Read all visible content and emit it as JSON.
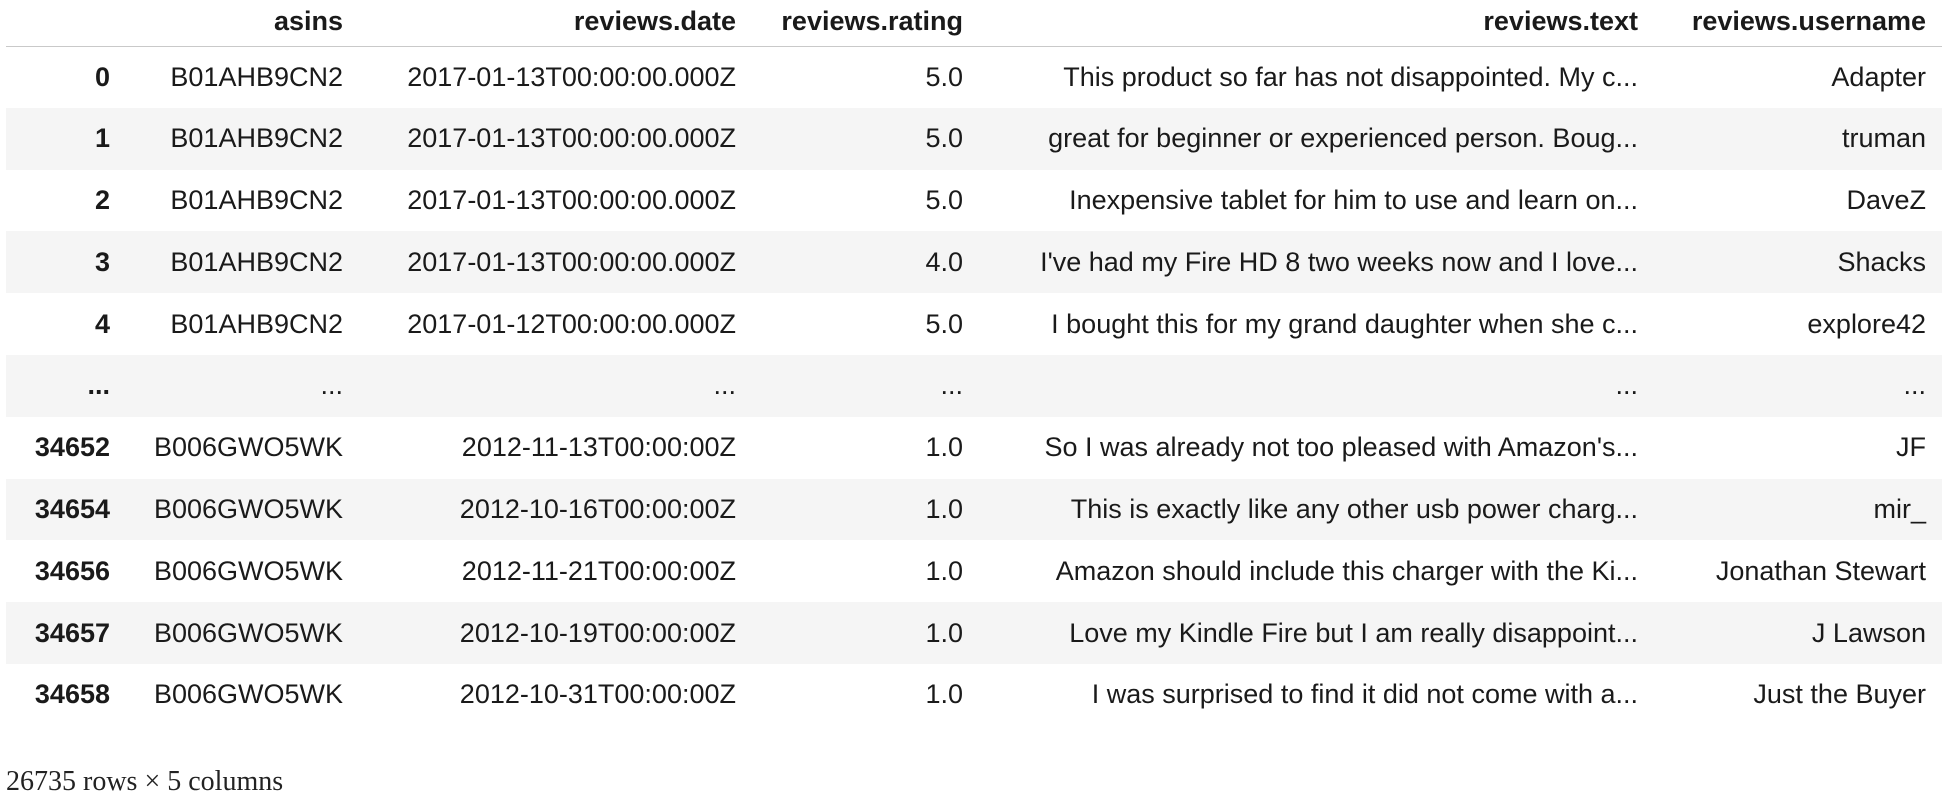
{
  "table": {
    "columns": [
      "",
      "asins",
      "reviews.date",
      "reviews.rating",
      "reviews.text",
      "reviews.username"
    ],
    "rows": [
      {
        "index": "0",
        "asins": "B01AHB9CN2",
        "date": "2017-01-13T00:00:00.000Z",
        "rating": "5.0",
        "text": "This product so far has not disappointed. My c...",
        "username": "Adapter"
      },
      {
        "index": "1",
        "asins": "B01AHB9CN2",
        "date": "2017-01-13T00:00:00.000Z",
        "rating": "5.0",
        "text": "great for beginner or experienced person. Boug...",
        "username": "truman"
      },
      {
        "index": "2",
        "asins": "B01AHB9CN2",
        "date": "2017-01-13T00:00:00.000Z",
        "rating": "5.0",
        "text": "Inexpensive tablet for him to use and learn on...",
        "username": "DaveZ"
      },
      {
        "index": "3",
        "asins": "B01AHB9CN2",
        "date": "2017-01-13T00:00:00.000Z",
        "rating": "4.0",
        "text": "I've had my Fire HD 8 two weeks now and I love...",
        "username": "Shacks"
      },
      {
        "index": "4",
        "asins": "B01AHB9CN2",
        "date": "2017-01-12T00:00:00.000Z",
        "rating": "5.0",
        "text": "I bought this for my grand daughter when she c...",
        "username": "explore42"
      },
      {
        "index": "...",
        "asins": "...",
        "date": "...",
        "rating": "...",
        "text": "...",
        "username": "..."
      },
      {
        "index": "34652",
        "asins": "B006GWO5WK",
        "date": "2012-11-13T00:00:00Z",
        "rating": "1.0",
        "text": "So I was already not too pleased with Amazon's...",
        "username": "JF"
      },
      {
        "index": "34654",
        "asins": "B006GWO5WK",
        "date": "2012-10-16T00:00:00Z",
        "rating": "1.0",
        "text": "This is exactly like any other usb power charg...",
        "username": "mir_"
      },
      {
        "index": "34656",
        "asins": "B006GWO5WK",
        "date": "2012-11-21T00:00:00Z",
        "rating": "1.0",
        "text": "Amazon should include this charger with the Ki...",
        "username": "Jonathan Stewart"
      },
      {
        "index": "34657",
        "asins": "B006GWO5WK",
        "date": "2012-10-19T00:00:00Z",
        "rating": "1.0",
        "text": "Love my Kindle Fire but I am really disappoint...",
        "username": "J Lawson"
      },
      {
        "index": "34658",
        "asins": "B006GWO5WK",
        "date": "2012-10-31T00:00:00Z",
        "rating": "1.0",
        "text": "I was surprised to find it did not come with a...",
        "username": "Just the Buyer"
      }
    ]
  },
  "footer": {
    "shape": "26735 rows × 5 columns"
  }
}
